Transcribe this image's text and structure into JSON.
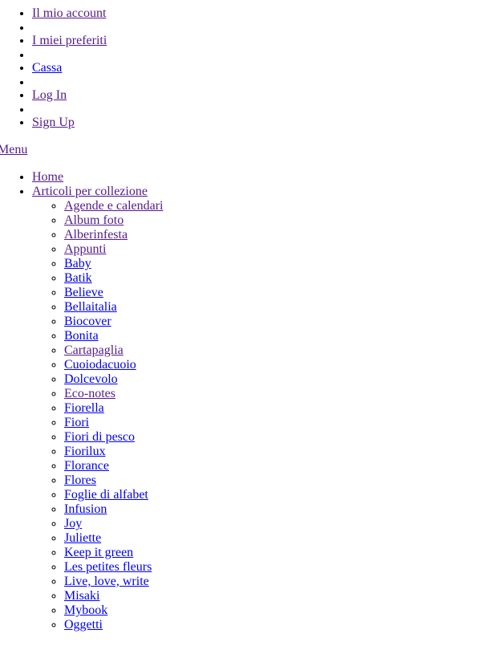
{
  "page": {
    "language": "it",
    "style_state": "unstyled-fallback",
    "link_color_unvisited": "#0000EE",
    "link_color_visited": "#551A8B",
    "text_color": "#000000",
    "background_color": "#FFFFFF"
  },
  "utility_nav": {
    "items": [
      {
        "label": "Il mio account",
        "visited": true
      },
      {
        "label": "",
        "visited": false,
        "empty": true
      },
      {
        "label": "I miei preferiti",
        "visited": true
      },
      {
        "label": "",
        "visited": false,
        "empty": true
      },
      {
        "label": "Cassa",
        "visited": false
      },
      {
        "label": "",
        "visited": false,
        "empty": true
      },
      {
        "label": "Log In",
        "visited": true
      },
      {
        "label": "",
        "visited": false,
        "empty": true
      },
      {
        "label": "Sign Up",
        "visited": true
      }
    ]
  },
  "menu_toggle": {
    "label": "Menu",
    "visited": true
  },
  "main_nav": {
    "items": [
      {
        "label": "Home",
        "visited": true
      },
      {
        "label": "Articoli per collezione",
        "visited": true
      }
    ],
    "collections_label": "Articoli per collezione",
    "collections": [
      {
        "label": "Agende e calendari",
        "visited": true
      },
      {
        "label": "Album foto",
        "visited": true
      },
      {
        "label": "Alberinfesta",
        "visited": true
      },
      {
        "label": "Appunti",
        "visited": true
      },
      {
        "label": "Baby",
        "visited": false
      },
      {
        "label": "Batik",
        "visited": false
      },
      {
        "label": "Believe",
        "visited": false
      },
      {
        "label": "Bellaitalia",
        "visited": false
      },
      {
        "label": "Biocover",
        "visited": false
      },
      {
        "label": "Bonita",
        "visited": false
      },
      {
        "label": "Cartapaglia",
        "visited": true
      },
      {
        "label": "Cuoiodacuoio",
        "visited": false
      },
      {
        "label": "Dolcevolo",
        "visited": false
      },
      {
        "label": "Eco-notes",
        "visited": true
      },
      {
        "label": "Fiorella",
        "visited": false
      },
      {
        "label": "Fiori",
        "visited": false
      },
      {
        "label": "Fiori di pesco",
        "visited": false
      },
      {
        "label": "Fiorilux",
        "visited": false
      },
      {
        "label": "Florance",
        "visited": false
      },
      {
        "label": "Flores",
        "visited": false
      },
      {
        "label": "Foglie di alfabet",
        "visited": false
      },
      {
        "label": "Infusion",
        "visited": false
      },
      {
        "label": "Joy",
        "visited": false
      },
      {
        "label": "Juliette",
        "visited": false
      },
      {
        "label": "Keep it green",
        "visited": false
      },
      {
        "label": "Les petites fleurs",
        "visited": false
      },
      {
        "label": "Live, love, write",
        "visited": false
      },
      {
        "label": "Misaki",
        "visited": false
      },
      {
        "label": "Mybook",
        "visited": false
      },
      {
        "label": "Oggetti",
        "visited": false
      }
    ]
  }
}
